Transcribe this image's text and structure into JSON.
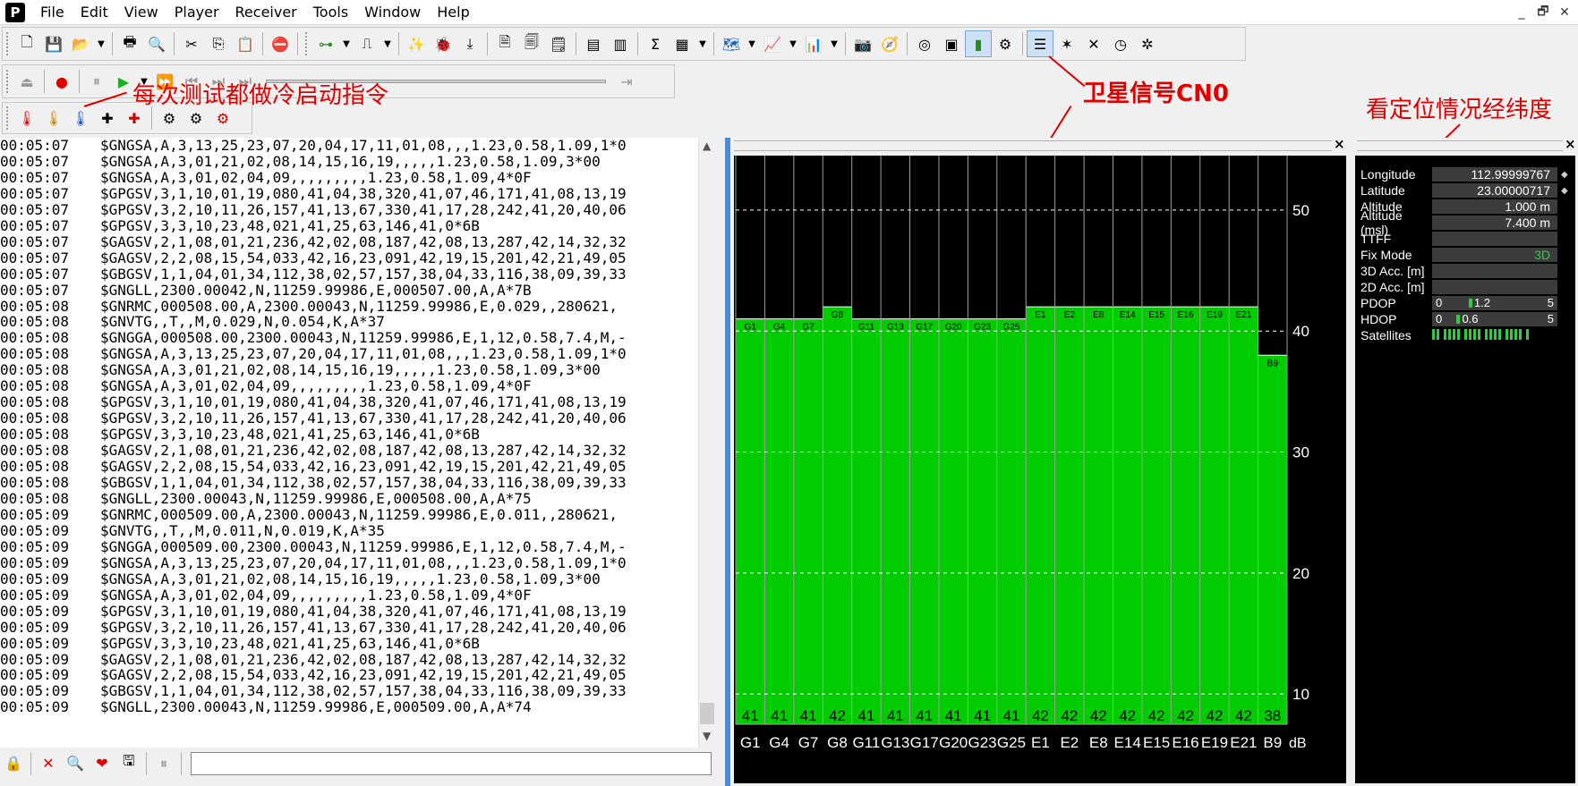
{
  "app": {
    "icon_letter": "P"
  },
  "menu": [
    "File",
    "Edit",
    "View",
    "Player",
    "Receiver",
    "Tools",
    "Window",
    "Help"
  ],
  "window_controls": [
    "_",
    "🗗",
    "✕"
  ],
  "annotations": {
    "cold_start": "每次测试都做冷启动指令",
    "cn0": "卫星信号CN0",
    "position": "看定位情况经纬度"
  },
  "log": [
    [
      "00:05:07",
      "$GNGSA,A,3,13,25,23,07,20,04,17,11,01,08,,,1.23,0.58,1.09,1*0"
    ],
    [
      "00:05:07",
      "$GNGSA,A,3,01,21,02,08,14,15,16,19,,,,,1.23,0.58,1.09,3*00"
    ],
    [
      "00:05:07",
      "$GNGSA,A,3,01,02,04,09,,,,,,,,,1.23,0.58,1.09,4*0F"
    ],
    [
      "00:05:07",
      "$GPGSV,3,1,10,01,19,080,41,04,38,320,41,07,46,171,41,08,13,19"
    ],
    [
      "00:05:07",
      "$GPGSV,3,2,10,11,26,157,41,13,67,330,41,17,28,242,41,20,40,06"
    ],
    [
      "00:05:07",
      "$GPGSV,3,3,10,23,48,021,41,25,63,146,41,0*6B"
    ],
    [
      "00:05:07",
      "$GAGSV,2,1,08,01,21,236,42,02,08,187,42,08,13,287,42,14,32,32"
    ],
    [
      "00:05:07",
      "$GAGSV,2,2,08,15,54,033,42,16,23,091,42,19,15,201,42,21,49,05"
    ],
    [
      "00:05:07",
      "$GBGSV,1,1,04,01,34,112,38,02,57,157,38,04,33,116,38,09,39,33"
    ],
    [
      "00:05:07",
      "$GNGLL,2300.00042,N,11259.99986,E,000507.00,A,A*7B"
    ],
    [
      "00:05:08",
      "$GNRMC,000508.00,A,2300.00043,N,11259.99986,E,0.029,,280621,"
    ],
    [
      "00:05:08",
      "$GNVTG,,T,,M,0.029,N,0.054,K,A*37"
    ],
    [
      "00:05:08",
      "$GNGGA,000508.00,2300.00043,N,11259.99986,E,1,12,0.58,7.4,M,-"
    ],
    [
      "00:05:08",
      "$GNGSA,A,3,13,25,23,07,20,04,17,11,01,08,,,1.23,0.58,1.09,1*0"
    ],
    [
      "00:05:08",
      "$GNGSA,A,3,01,21,02,08,14,15,16,19,,,,,1.23,0.58,1.09,3*00"
    ],
    [
      "00:05:08",
      "$GNGSA,A,3,01,02,04,09,,,,,,,,,1.23,0.58,1.09,4*0F"
    ],
    [
      "00:05:08",
      "$GPGSV,3,1,10,01,19,080,41,04,38,320,41,07,46,171,41,08,13,19"
    ],
    [
      "00:05:08",
      "$GPGSV,3,2,10,11,26,157,41,13,67,330,41,17,28,242,41,20,40,06"
    ],
    [
      "00:05:08",
      "$GPGSV,3,3,10,23,48,021,41,25,63,146,41,0*6B"
    ],
    [
      "00:05:08",
      "$GAGSV,2,1,08,01,21,236,42,02,08,187,42,08,13,287,42,14,32,32"
    ],
    [
      "00:05:08",
      "$GAGSV,2,2,08,15,54,033,42,16,23,091,42,19,15,201,42,21,49,05"
    ],
    [
      "00:05:08",
      "$GBGSV,1,1,04,01,34,112,38,02,57,157,38,04,33,116,38,09,39,33"
    ],
    [
      "00:05:08",
      "$GNGLL,2300.00043,N,11259.99986,E,000508.00,A,A*75"
    ],
    [
      "00:05:09",
      "$GNRMC,000509.00,A,2300.00043,N,11259.99986,E,0.011,,280621,"
    ],
    [
      "00:05:09",
      "$GNVTG,,T,,M,0.011,N,0.019,K,A*35"
    ],
    [
      "00:05:09",
      "$GNGGA,000509.00,2300.00043,N,11259.99986,E,1,12,0.58,7.4,M,-"
    ],
    [
      "00:05:09",
      "$GNGSA,A,3,13,25,23,07,20,04,17,11,01,08,,,1.23,0.58,1.09,1*0"
    ],
    [
      "00:05:09",
      "$GNGSA,A,3,01,21,02,08,14,15,16,19,,,,,1.23,0.58,1.09,3*00"
    ],
    [
      "00:05:09",
      "$GNGSA,A,3,01,02,04,09,,,,,,,,,1.23,0.58,1.09,4*0F"
    ],
    [
      "00:05:09",
      "$GPGSV,3,1,10,01,19,080,41,04,38,320,41,07,46,171,41,08,13,19"
    ],
    [
      "00:05:09",
      "$GPGSV,3,2,10,11,26,157,41,13,67,330,41,17,28,242,41,20,40,06"
    ],
    [
      "00:05:09",
      "$GPGSV,3,3,10,23,48,021,41,25,63,146,41,0*6B"
    ],
    [
      "00:05:09",
      "$GAGSV,2,1,08,01,21,236,42,02,08,187,42,08,13,287,42,14,32,32"
    ],
    [
      "00:05:09",
      "$GAGSV,2,2,08,15,54,033,42,16,23,091,42,19,15,201,42,21,49,05"
    ],
    [
      "00:05:09",
      "$GBGSV,1,1,04,01,34,112,38,02,57,157,38,04,33,116,38,09,39,33"
    ],
    [
      "00:05:09",
      "$GNGLL,2300.00043,N,11259.99986,E,000509.00,A,A*74"
    ]
  ],
  "chart_data": {
    "type": "bar",
    "categories": [
      "G1",
      "G4",
      "G7",
      "G8",
      "G11",
      "G13",
      "G17",
      "G20",
      "G23",
      "G25",
      "E1",
      "E2",
      "E8",
      "E14",
      "E15",
      "E16",
      "E19",
      "E21",
      "B9"
    ],
    "values": [
      41,
      41,
      41,
      42,
      41,
      41,
      41,
      41,
      41,
      41,
      42,
      42,
      42,
      42,
      42,
      42,
      42,
      42,
      38
    ],
    "unit_label": "dB",
    "y_ticks": [
      10,
      20,
      30,
      40,
      50
    ],
    "ylim": [
      7.5,
      54.5
    ],
    "colors": {
      "bar": "#00cc00",
      "background": "#000000",
      "grid": "#a0a0a0",
      "text": "#ffffff"
    }
  },
  "nav": {
    "rows": [
      {
        "label": "Longitude",
        "value": "112.99999767"
      },
      {
        "label": "Latitude",
        "value": "23.00000717"
      },
      {
        "label": "Altitude",
        "value": "1.000 m"
      },
      {
        "label": "Altitude (msl)",
        "value": "7.400 m"
      },
      {
        "label": "TTFF",
        "value": ""
      },
      {
        "label": "Fix Mode",
        "value": "3D"
      },
      {
        "label": "3D Acc. [m]",
        "value": ""
      },
      {
        "label": "2D Acc. [m]",
        "value": ""
      }
    ],
    "pdop": {
      "label": "PDOP",
      "min": "0",
      "value": "1.2",
      "max": "5"
    },
    "hdop": {
      "label": "HDOP",
      "min": "0",
      "value": "0.6",
      "max": "5"
    },
    "satellites": {
      "label": "Satellites",
      "count": 19
    }
  }
}
